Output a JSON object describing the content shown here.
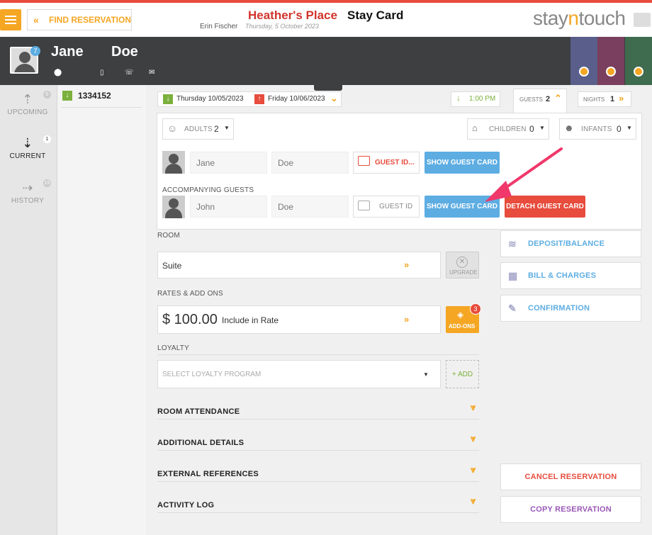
{
  "header": {
    "find_label": "FIND RESERVATION",
    "hotel_name": "Heather's Place",
    "page_title": "Stay Card",
    "user_name": "Erin Fischer",
    "business_date": "Thursday, 5 October 2023",
    "logo_part1": "stay",
    "logo_part2": "n",
    "logo_part3": "touch"
  },
  "guest": {
    "first_name": "Jane",
    "last_name": "Doe",
    "avatar_badge": "7"
  },
  "sidebar": {
    "items": [
      {
        "label": "UPCOMING",
        "count": "0"
      },
      {
        "label": "CURRENT",
        "count": "1"
      },
      {
        "label": "HISTORY",
        "count": "15"
      }
    ]
  },
  "reservation": {
    "number": "1334152",
    "arrival": "Thursday 10/05/2023",
    "departure": "Friday 10/06/2023",
    "time": "1:00 PM",
    "guests_label": "GUESTS",
    "guests_value": "2",
    "nights_label": "NIGHTS",
    "nights_value": "1"
  },
  "guests_panel": {
    "adults_label": "ADULTS",
    "adults_value": "2",
    "children_label": "CHILDREN",
    "children_value": "0",
    "infants_label": "INFANTS",
    "infants_value": "0",
    "primary": {
      "first": "Jane",
      "last": "Doe",
      "id_label": "GUEST ID...",
      "show_card": "SHOW GUEST CARD"
    },
    "accompanying_title": "ACCOMPANYING GUESTS",
    "accompanying": {
      "first": "John",
      "last": "Doe",
      "id_label": "GUEST ID",
      "show_card": "SHOW GUEST CARD",
      "detach": "DETACH GUEST CARD"
    }
  },
  "room": {
    "section_label": "ROOM",
    "type": "Suite",
    "upgrade_label": "UPGRADE"
  },
  "rates": {
    "section_label": "RATES & ADD ONS",
    "amount": "$ 100.00",
    "rate_name": "Include in Rate",
    "addons_label": "ADD-ONS",
    "addons_count": "3"
  },
  "loyalty": {
    "section_label": "LOYALTY",
    "placeholder": "SELECT LOYALTY PROGRAM",
    "add_label": "+ ADD"
  },
  "sections": [
    "ROOM ATTENDANCE",
    "ADDITIONAL DETAILS",
    "EXTERNAL REFERENCES",
    "ACTIVITY LOG"
  ],
  "right_actions": {
    "deposit": "DEPOSIT/BALANCE",
    "bill": "BILL & CHARGES",
    "confirmation": "CONFIRMATION",
    "cancel": "CANCEL RESERVATION",
    "copy": "COPY RESERVATION"
  },
  "colors": {
    "accent": "#f5a623",
    "danger": "#e74c3c",
    "info": "#5dade2",
    "purple": "#9b59b6",
    "annotation": "#f0386b"
  }
}
